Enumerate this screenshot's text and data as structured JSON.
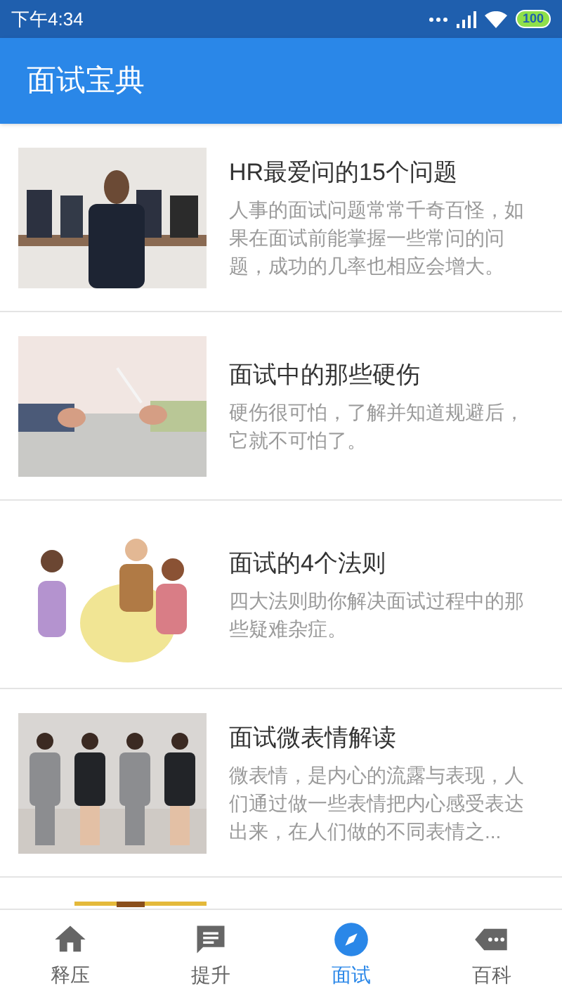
{
  "status_bar": {
    "time": "下午4:34",
    "battery": "100"
  },
  "app_bar": {
    "title": "面试宝典"
  },
  "articles": [
    {
      "picture": {
        "kind": "picture"
      },
      "title": "HR最爱问的15个问题",
      "summary": "人事的面试问题常常千奇百怪，如果在面试前能掌握一些常问的问题，成功的几率也相应会增大。"
    },
    {
      "picture": {
        "kind": "picture"
      },
      "title": "面试中的那些硬伤",
      "summary": "硬伤很可怕，了解并知道规避后，它就不可怕了。"
    },
    {
      "picture": {
        "kind": "picture"
      },
      "title": "面试的4个法则",
      "summary": "四大法则助你解决面试过程中的那些疑难杂症。"
    },
    {
      "picture": {
        "kind": "picture"
      },
      "title": "面试微表情解读",
      "summary": "微表情，是内心的流露与表现，人们通过做一些表情把内心感受表达出来，在人们做的不同表情之..."
    },
    {
      "picture": {
        "kind": "picture"
      }
    }
  ],
  "bottom_nav": [
    {
      "label": "释压",
      "selected": false
    },
    {
      "label": "提升",
      "selected": false
    },
    {
      "label": "面试",
      "selected": true
    },
    {
      "label": "百科",
      "selected": false
    }
  ]
}
